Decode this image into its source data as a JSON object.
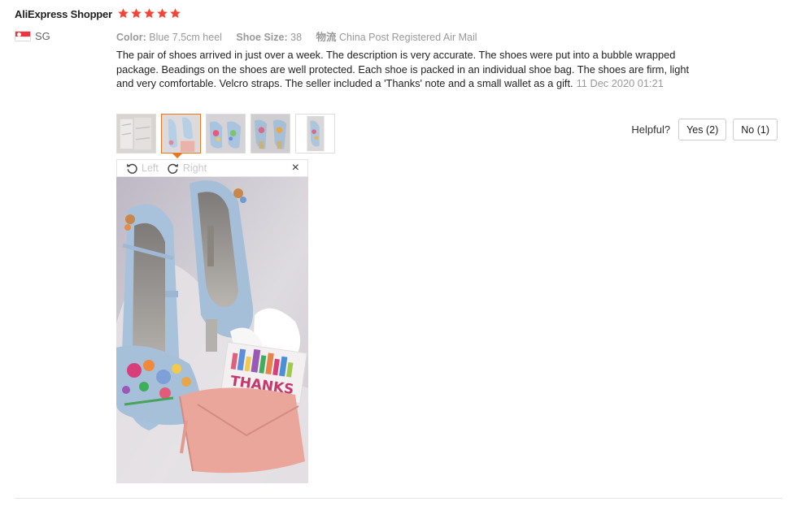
{
  "review": {
    "user_name": "AliExpress Shopper",
    "rating": 5,
    "country_code": "SG",
    "meta": {
      "color_key": "Color:",
      "color_value": "Blue 7.5cm heel",
      "size_key": "Shoe Size:",
      "size_value": "38",
      "logistics_key": "物流",
      "logistics_value": "China Post Registered Air Mail"
    },
    "text": "The pair of shoes arrived in just over a week. The description is very accurate. The shoes were put into a bubble wrapped package. Beadings on the shoes are well protected. Each shoe is packed in an individual shoe bag. The shoes are firm, light and very comfortable. Velcro straps. The seller included a 'Thanks' note and a small wallet as a gift.",
    "date": "11 Dec 2020 01:21",
    "thumbnail_count": 5,
    "active_thumbnail": 2
  },
  "helpful": {
    "label": "Helpful?",
    "yes_label": "Yes (2)",
    "no_label": "No (1)"
  },
  "viewer": {
    "rotate_left_label": "Left",
    "rotate_right_label": "Right",
    "close_label": "×",
    "card_text": "THANKS"
  },
  "colors": {
    "star": "#f44336",
    "active_border": "#e87722"
  }
}
